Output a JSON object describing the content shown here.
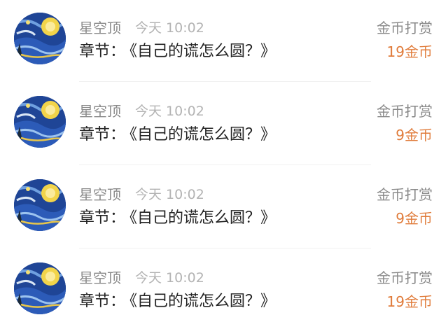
{
  "colors": {
    "amount": "#e07b3a",
    "secondary_text": "#8a8a8a",
    "timestamp": "#b3b3b3",
    "primary_text": "#222222"
  },
  "records": [
    {
      "user": "星空顶",
      "time": "今天 10:02",
      "chapter_label": "章节：",
      "chapter_title": "《自己的谎怎么圆？》",
      "tip_label": "金币打赏",
      "amount": "19金币"
    },
    {
      "user": "星空顶",
      "time": "今天 10:02",
      "chapter_label": "章节：",
      "chapter_title": "《自己的谎怎么圆？》",
      "tip_label": "金币打赏",
      "amount": "9金币"
    },
    {
      "user": "星空顶",
      "time": "今天 10:02",
      "chapter_label": "章节：",
      "chapter_title": "《自己的谎怎么圆？》",
      "tip_label": "金币打赏",
      "amount": "9金币"
    },
    {
      "user": "星空顶",
      "time": "今天 10:02",
      "chapter_label": "章节：",
      "chapter_title": "《自己的谎怎么圆？》",
      "tip_label": "金币打赏",
      "amount": "19金币"
    }
  ]
}
